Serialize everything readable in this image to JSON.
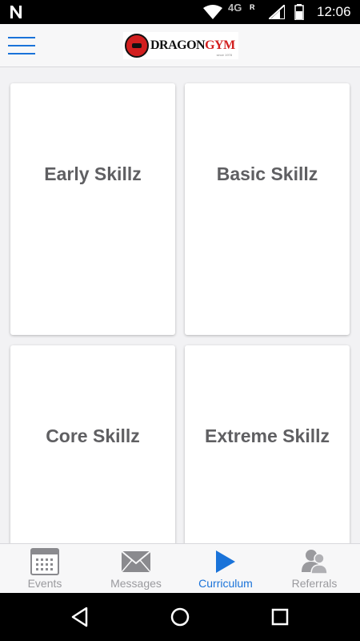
{
  "status_bar": {
    "network": "4G",
    "roaming": "R",
    "time": "12:06"
  },
  "header": {
    "logo": {
      "word1": "DRAGON",
      "word2": "GYM",
      "tagline": "since 1978",
      "colors": {
        "red": "#d21f1f",
        "black": "#111111"
      }
    }
  },
  "cards": [
    {
      "title": "Early Skillz"
    },
    {
      "title": "Basic Skillz"
    },
    {
      "title": "Core Skillz"
    },
    {
      "title": "Extreme Skillz"
    }
  ],
  "tabs": [
    {
      "label": "Events",
      "icon": "calendar-icon",
      "active": false
    },
    {
      "label": "Messages",
      "icon": "envelope-icon",
      "active": false
    },
    {
      "label": "Curriculum",
      "icon": "play-icon",
      "active": true
    },
    {
      "label": "Referrals",
      "icon": "people-icon",
      "active": false
    }
  ],
  "colors": {
    "accent": "#1a73d9",
    "card_text": "#5f5f62",
    "inactive": "#9a9a9e"
  }
}
